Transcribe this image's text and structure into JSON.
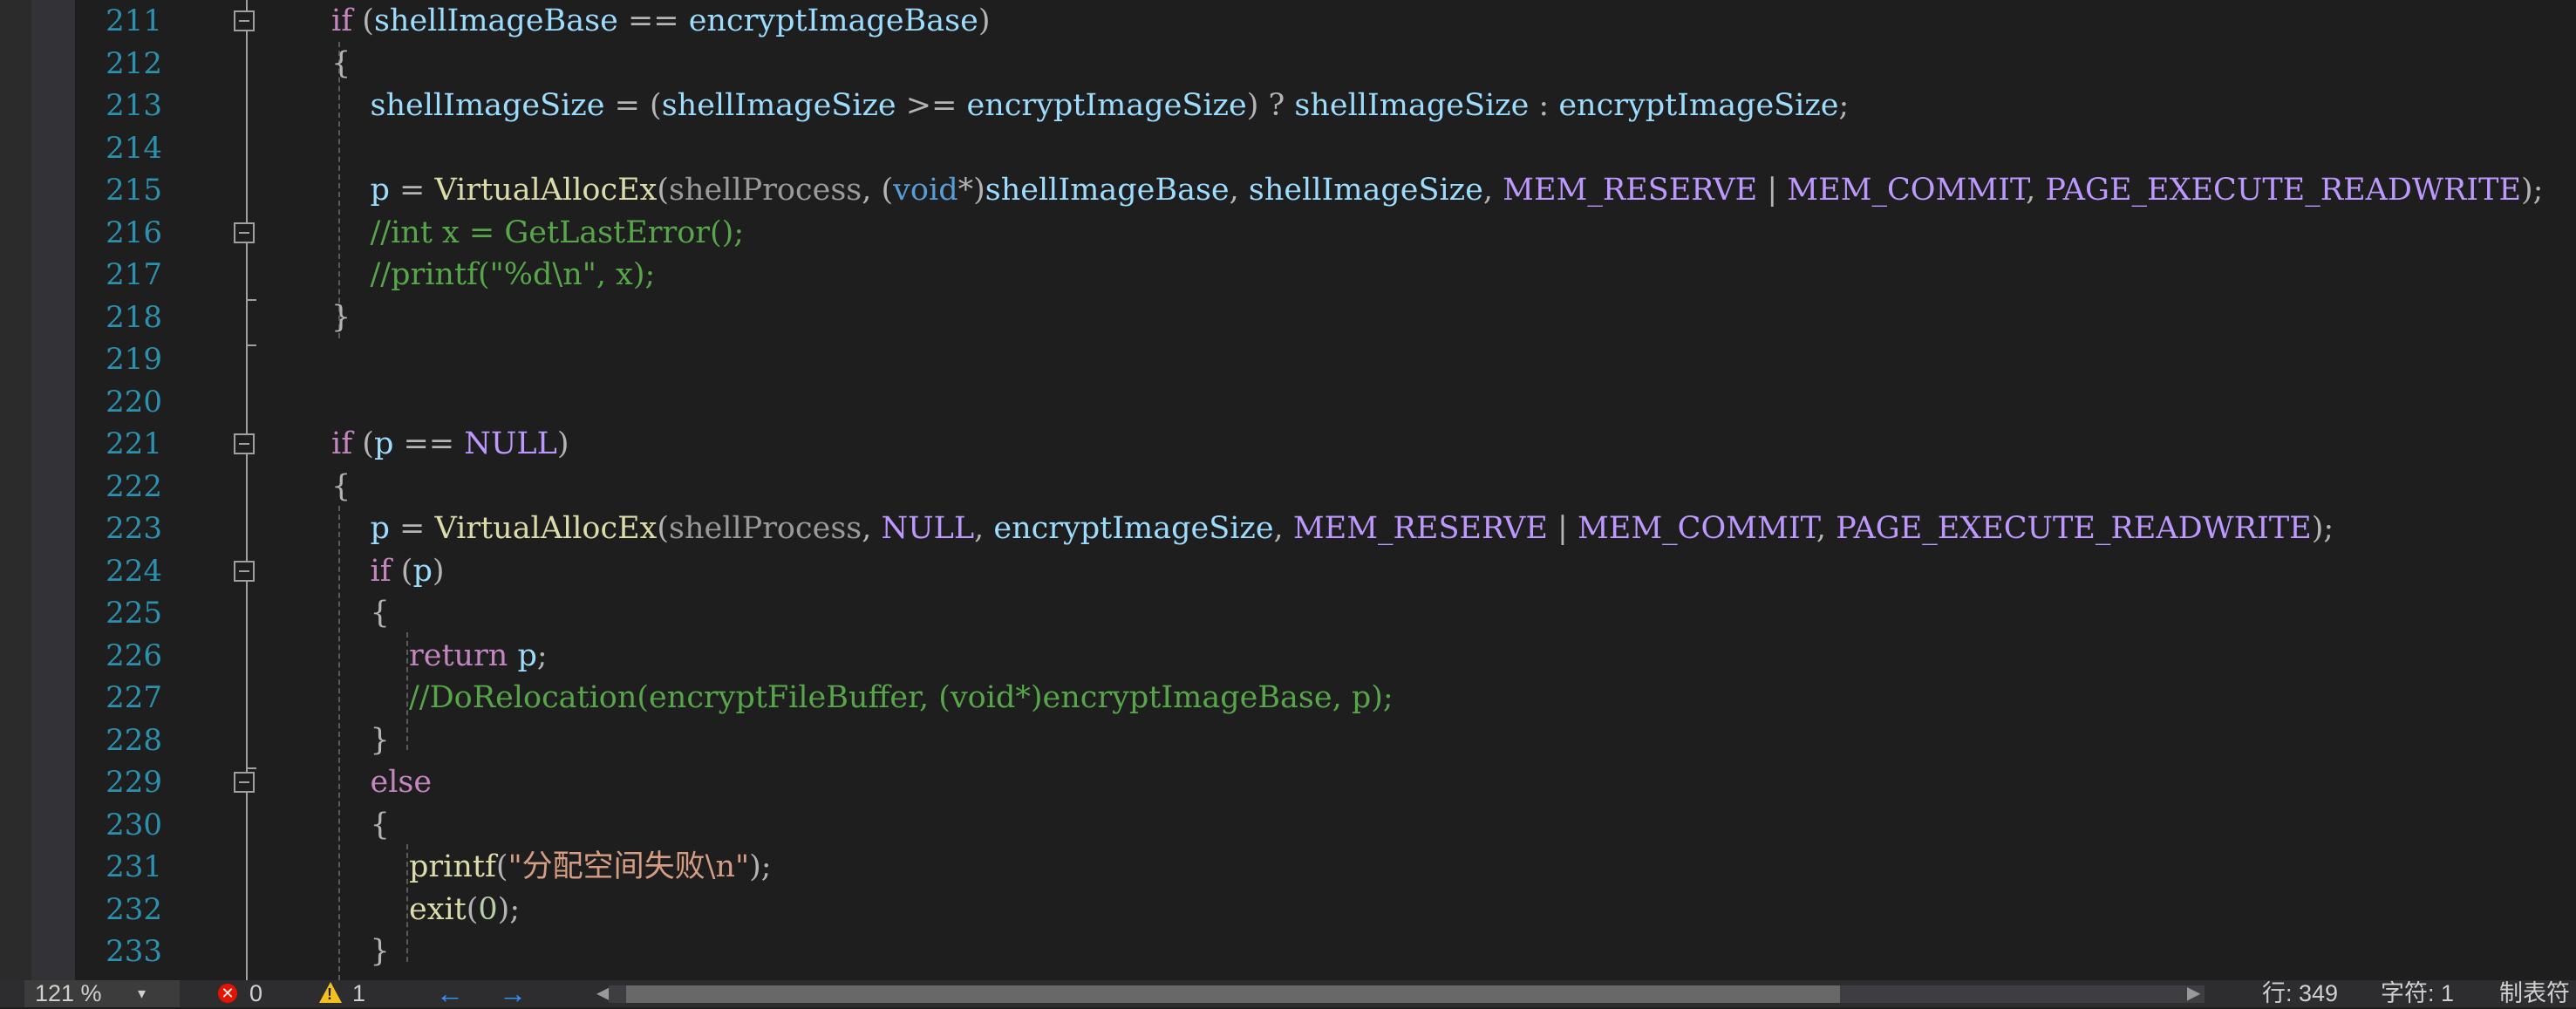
{
  "editor": {
    "lines": [
      {
        "num": "211",
        "fold": true
      },
      {
        "num": "212",
        "fold": false
      },
      {
        "num": "213",
        "fold": false
      },
      {
        "num": "214",
        "fold": false
      },
      {
        "num": "215",
        "fold": false
      },
      {
        "num": "216",
        "fold": true
      },
      {
        "num": "217",
        "fold": false
      },
      {
        "num": "218",
        "fold": false
      },
      {
        "num": "219",
        "fold": false
      },
      {
        "num": "220",
        "fold": false
      },
      {
        "num": "221",
        "fold": true
      },
      {
        "num": "222",
        "fold": false
      },
      {
        "num": "223",
        "fold": false
      },
      {
        "num": "224",
        "fold": true
      },
      {
        "num": "225",
        "fold": false
      },
      {
        "num": "226",
        "fold": false
      },
      {
        "num": "227",
        "fold": false
      },
      {
        "num": "228",
        "fold": false
      },
      {
        "num": "229",
        "fold": true
      },
      {
        "num": "230",
        "fold": false
      },
      {
        "num": "231",
        "fold": false
      },
      {
        "num": "232",
        "fold": false
      },
      {
        "num": "233",
        "fold": false
      }
    ],
    "code": [
      [
        {
          "t": "if",
          "c": "kw"
        },
        {
          "t": " (",
          "c": "pu"
        },
        {
          "t": "shellImageBase",
          "c": "var"
        },
        {
          "t": " == ",
          "c": "pu"
        },
        {
          "t": "encryptImageBase",
          "c": "var"
        },
        {
          "t": ")",
          "c": "pu"
        }
      ],
      [
        {
          "t": "{",
          "c": "pu"
        }
      ],
      [
        {
          "t": "    ",
          "c": "pu"
        },
        {
          "t": "shellImageSize",
          "c": "var"
        },
        {
          "t": " = (",
          "c": "pu"
        },
        {
          "t": "shellImageSize",
          "c": "var"
        },
        {
          "t": " >= ",
          "c": "pu"
        },
        {
          "t": "encryptImageSize",
          "c": "var"
        },
        {
          "t": ") ? ",
          "c": "pu"
        },
        {
          "t": "shellImageSize",
          "c": "var"
        },
        {
          "t": " : ",
          "c": "pu"
        },
        {
          "t": "encryptImageSize",
          "c": "var"
        },
        {
          "t": ";",
          "c": "pu"
        }
      ],
      [],
      [
        {
          "t": "    ",
          "c": "pu"
        },
        {
          "t": "p",
          "c": "var"
        },
        {
          "t": " = ",
          "c": "pu"
        },
        {
          "t": "VirtualAllocEx",
          "c": "fn"
        },
        {
          "t": "(",
          "c": "pu"
        },
        {
          "t": "shellProcess",
          "c": "par"
        },
        {
          "t": ", (",
          "c": "pu"
        },
        {
          "t": "void",
          "c": "kw2"
        },
        {
          "t": "*)",
          "c": "pu"
        },
        {
          "t": "shellImageBase",
          "c": "var"
        },
        {
          "t": ", ",
          "c": "pu"
        },
        {
          "t": "shellImageSize",
          "c": "var"
        },
        {
          "t": ", ",
          "c": "pu"
        },
        {
          "t": "MEM_RESERVE",
          "c": "mac"
        },
        {
          "t": " | ",
          "c": "pu"
        },
        {
          "t": "MEM_COMMIT",
          "c": "mac"
        },
        {
          "t": ", ",
          "c": "pu"
        },
        {
          "t": "PAGE_EXECUTE_READWRITE",
          "c": "mac"
        },
        {
          "t": ");",
          "c": "pu"
        }
      ],
      [
        {
          "t": "    ",
          "c": "pu"
        },
        {
          "t": "//int x = GetLastError();",
          "c": "cm"
        }
      ],
      [
        {
          "t": "    ",
          "c": "pu"
        },
        {
          "t": "//printf(\"%d\\n\", x);",
          "c": "cm"
        }
      ],
      [
        {
          "t": "}",
          "c": "pu"
        }
      ],
      [],
      [],
      [
        {
          "t": "if",
          "c": "kw"
        },
        {
          "t": " (",
          "c": "pu"
        },
        {
          "t": "p",
          "c": "var"
        },
        {
          "t": " == ",
          "c": "pu"
        },
        {
          "t": "NULL",
          "c": "mac"
        },
        {
          "t": ")",
          "c": "pu"
        }
      ],
      [
        {
          "t": "{",
          "c": "pu"
        }
      ],
      [
        {
          "t": "    ",
          "c": "pu"
        },
        {
          "t": "p",
          "c": "var"
        },
        {
          "t": " = ",
          "c": "pu"
        },
        {
          "t": "VirtualAllocEx",
          "c": "fn"
        },
        {
          "t": "(",
          "c": "pu"
        },
        {
          "t": "shellProcess",
          "c": "par"
        },
        {
          "t": ", ",
          "c": "pu"
        },
        {
          "t": "NULL",
          "c": "mac"
        },
        {
          "t": ", ",
          "c": "pu"
        },
        {
          "t": "encryptImageSize",
          "c": "var"
        },
        {
          "t": ", ",
          "c": "pu"
        },
        {
          "t": "MEM_RESERVE",
          "c": "mac"
        },
        {
          "t": " | ",
          "c": "pu"
        },
        {
          "t": "MEM_COMMIT",
          "c": "mac"
        },
        {
          "t": ", ",
          "c": "pu"
        },
        {
          "t": "PAGE_EXECUTE_READWRITE",
          "c": "mac"
        },
        {
          "t": ");",
          "c": "pu"
        }
      ],
      [
        {
          "t": "    ",
          "c": "pu"
        },
        {
          "t": "if",
          "c": "kw"
        },
        {
          "t": " (",
          "c": "pu"
        },
        {
          "t": "p",
          "c": "var"
        },
        {
          "t": ")",
          "c": "pu"
        }
      ],
      [
        {
          "t": "    ",
          "c": "pu"
        },
        {
          "t": "{",
          "c": "pu"
        }
      ],
      [
        {
          "t": "        ",
          "c": "pu"
        },
        {
          "t": "return",
          "c": "kw"
        },
        {
          "t": " ",
          "c": "pu"
        },
        {
          "t": "p",
          "c": "var"
        },
        {
          "t": ";",
          "c": "pu"
        }
      ],
      [
        {
          "t": "        ",
          "c": "pu"
        },
        {
          "t": "//DoRelocation(encryptFileBuffer, (void*)encryptImageBase, p);",
          "c": "cm"
        }
      ],
      [
        {
          "t": "    ",
          "c": "pu"
        },
        {
          "t": "}",
          "c": "pu"
        }
      ],
      [
        {
          "t": "    ",
          "c": "pu"
        },
        {
          "t": "else",
          "c": "kw"
        }
      ],
      [
        {
          "t": "    ",
          "c": "pu"
        },
        {
          "t": "{",
          "c": "pu"
        }
      ],
      [
        {
          "t": "        ",
          "c": "pu"
        },
        {
          "t": "printf",
          "c": "fn"
        },
        {
          "t": "(",
          "c": "pu"
        },
        {
          "t": "\"分配空间失败\\n\"",
          "c": "str"
        },
        {
          "t": ");",
          "c": "pu"
        }
      ],
      [
        {
          "t": "        ",
          "c": "pu"
        },
        {
          "t": "exit",
          "c": "fn"
        },
        {
          "t": "(",
          "c": "pu"
        },
        {
          "t": "0",
          "c": "num"
        },
        {
          "t": ");",
          "c": "pu"
        }
      ],
      [
        {
          "t": "    ",
          "c": "pu"
        },
        {
          "t": "}",
          "c": "pu"
        }
      ]
    ]
  },
  "statusbar": {
    "zoom": "121 %",
    "errors": "0",
    "warnings": "1",
    "back_arrow": "←",
    "forward_arrow": "→",
    "line_label": "行: 349",
    "char_label": "字符: 1",
    "tab_label": "制表符"
  },
  "colors": {
    "background": "#1e1e1e",
    "line_number": "#2b91af",
    "keyword": "#c586c0",
    "variable": "#9cdcfe",
    "function": "#dcdcaa",
    "macro": "#bd98ff",
    "comment": "#57a64a",
    "string": "#d69d85"
  }
}
